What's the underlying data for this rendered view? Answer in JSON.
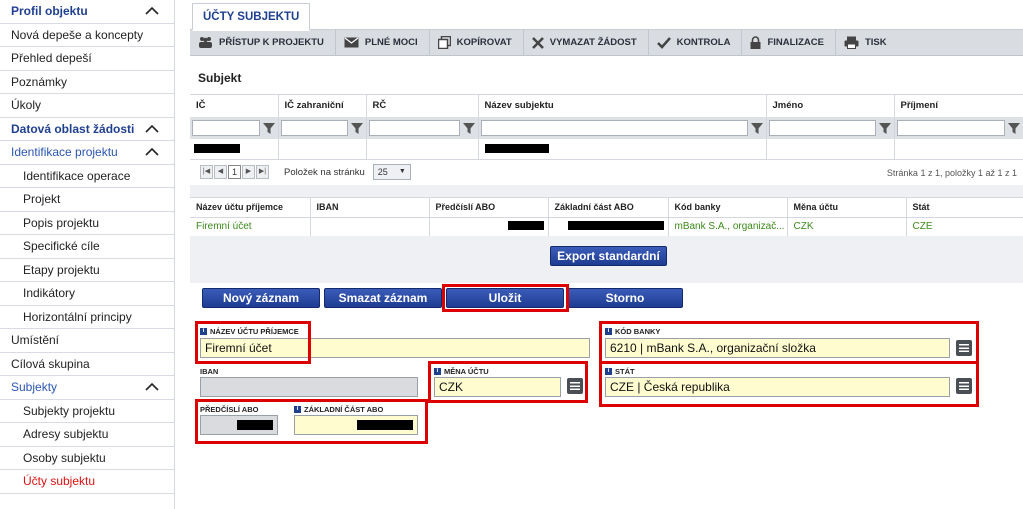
{
  "sidebar": {
    "items": [
      {
        "label": "Profil objektu",
        "kind": "section",
        "chevron": true
      },
      {
        "label": "Nová depeše a koncepty",
        "kind": "item"
      },
      {
        "label": "Přehled depeší",
        "kind": "item"
      },
      {
        "label": "Poznámky",
        "kind": "item"
      },
      {
        "label": "Úkoly",
        "kind": "item"
      },
      {
        "label": "Datová oblast žádosti",
        "kind": "section",
        "chevron": true
      },
      {
        "label": "Identifikace projektu",
        "kind": "section-blue",
        "chevron": true
      },
      {
        "label": "Identifikace operace",
        "kind": "sub"
      },
      {
        "label": "Projekt",
        "kind": "sub"
      },
      {
        "label": "Popis projektu",
        "kind": "sub"
      },
      {
        "label": "Specifické cíle",
        "kind": "sub"
      },
      {
        "label": "Etapy projektu",
        "kind": "sub"
      },
      {
        "label": "Indikátory",
        "kind": "sub"
      },
      {
        "label": "Horizontální principy",
        "kind": "sub"
      },
      {
        "label": "Umístění",
        "kind": "item"
      },
      {
        "label": "Cílová skupina",
        "kind": "item"
      },
      {
        "label": "Subjekty",
        "kind": "section-blue",
        "chevron": true
      },
      {
        "label": "Subjekty projektu",
        "kind": "sub"
      },
      {
        "label": "Adresy subjektu",
        "kind": "sub"
      },
      {
        "label": "Osoby subjektu",
        "kind": "sub"
      },
      {
        "label": "Účty subjektu",
        "kind": "sub-active"
      }
    ]
  },
  "tab": {
    "label": "ÚČTY SUBJEKTU"
  },
  "toolbar": {
    "access": "PŘÍSTUP K PROJEKTU",
    "power": "PLNÉ MOCI",
    "copy": "KOPÍROVAT",
    "delete": "VYMAZAT ŽÁDOST",
    "check": "KONTROLA",
    "finalize": "FINALIZACE",
    "print": "TISK"
  },
  "subject_grid": {
    "title": "Subjekt",
    "columns": [
      "IČ",
      "IČ zahraniční",
      "RČ",
      "Název subjektu",
      "Jméno",
      "Příjmení"
    ],
    "pager": {
      "page": "1",
      "per_page_label": "Položek na stránku",
      "per_page_value": "25",
      "info": "Stránka 1 z 1, položky 1 až 1 z 1"
    }
  },
  "accounts_grid": {
    "columns": [
      "Název účtu příjemce",
      "IBAN",
      "Předčíslí ABO",
      "Základní část ABO",
      "Kód banky",
      "Měna účtu",
      "Stát"
    ],
    "row": {
      "name": "Firemní účet",
      "iban": "",
      "bank": "mBank S.A., organizač...",
      "currency": "CZK",
      "country": "CZE"
    },
    "export_label": "Export standardní"
  },
  "actions": {
    "new": "Nový záznam",
    "delete": "Smazat záznam",
    "save": "Uložit",
    "cancel": "Storno"
  },
  "form": {
    "account_name_label": "NÁZEV ÚČTU PŘÍJEMCE",
    "account_name_value": "Firemní účet",
    "bank_code_label": "KÓD BANKY",
    "bank_code_value": "6210 | mBank S.A., organizační složka",
    "iban_label": "IBAN",
    "iban_value": "",
    "currency_label": "MĚNA ÚČTU",
    "currency_value": "CZK",
    "country_label": "STÁT",
    "country_value": "CZE | Česká republika",
    "prefix_label": "PŘEDČÍSLÍ ABO",
    "base_label": "ZÁKLADNÍ ČÁST ABO"
  },
  "colors": {
    "accent": "#1f3f8f",
    "highlight": "#dd0000",
    "green_text": "#3b8a1a"
  }
}
